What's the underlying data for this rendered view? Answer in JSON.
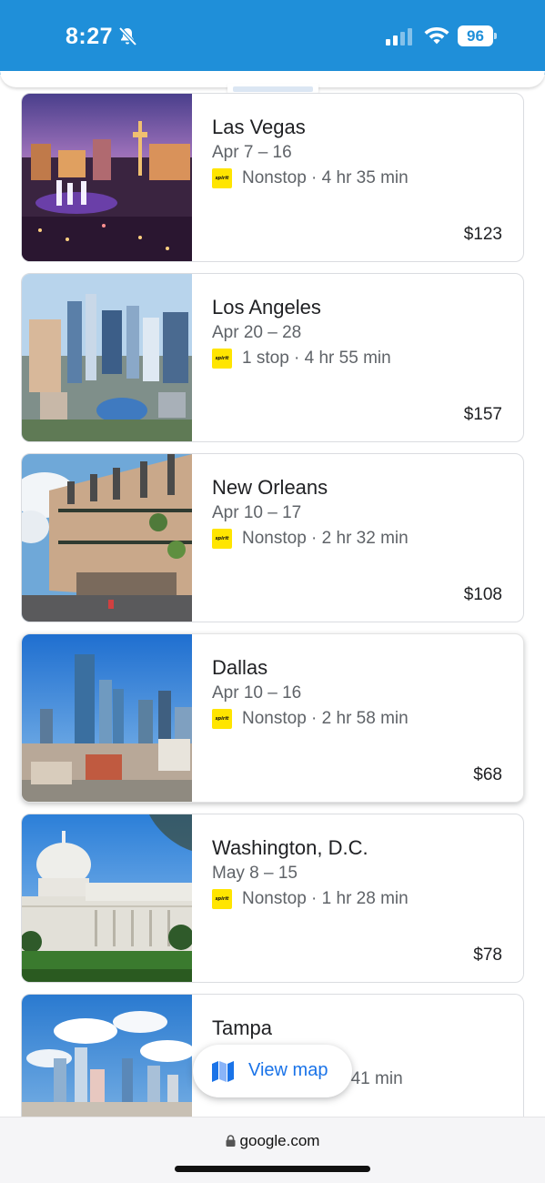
{
  "status_bar": {
    "time": "8:27",
    "battery": "96",
    "icons": [
      "bell-off-icon",
      "cellular-signal-icon",
      "wifi-icon",
      "battery-icon"
    ]
  },
  "destinations": [
    {
      "city": "Las Vegas",
      "dates": "Apr 7 – 16",
      "airline_logo": "spirit",
      "flight": "Nonstop · 4 hr 35 min",
      "price": "$123"
    },
    {
      "city": "Los Angeles",
      "dates": "Apr 20 – 28",
      "airline_logo": "spirit",
      "flight": "1 stop · 4 hr 55 min",
      "price": "$157"
    },
    {
      "city": "New Orleans",
      "dates": "Apr 10 – 17",
      "airline_logo": "spirit",
      "flight": "Nonstop · 2 hr 32 min",
      "price": "$108"
    },
    {
      "city": "Dallas",
      "dates": "Apr 10 – 16",
      "airline_logo": "spirit",
      "flight": "Nonstop · 2 hr 58 min",
      "price": "$68"
    },
    {
      "city": "Washington, D.C.",
      "dates": "May 8 – 15",
      "airline_logo": "spirit",
      "flight": "Nonstop · 1 hr 28 min",
      "price": "$78"
    },
    {
      "city": "Tampa",
      "flight_visible": "r 41 min"
    }
  ],
  "fab": {
    "label": "View map",
    "icon": "map-icon"
  },
  "browser": {
    "url": "google.com",
    "icon": "lock-icon"
  },
  "colors": {
    "status_bar": "#1f8fd9",
    "accent": "#1a73e8",
    "spirit_yellow": "#ffe500"
  }
}
